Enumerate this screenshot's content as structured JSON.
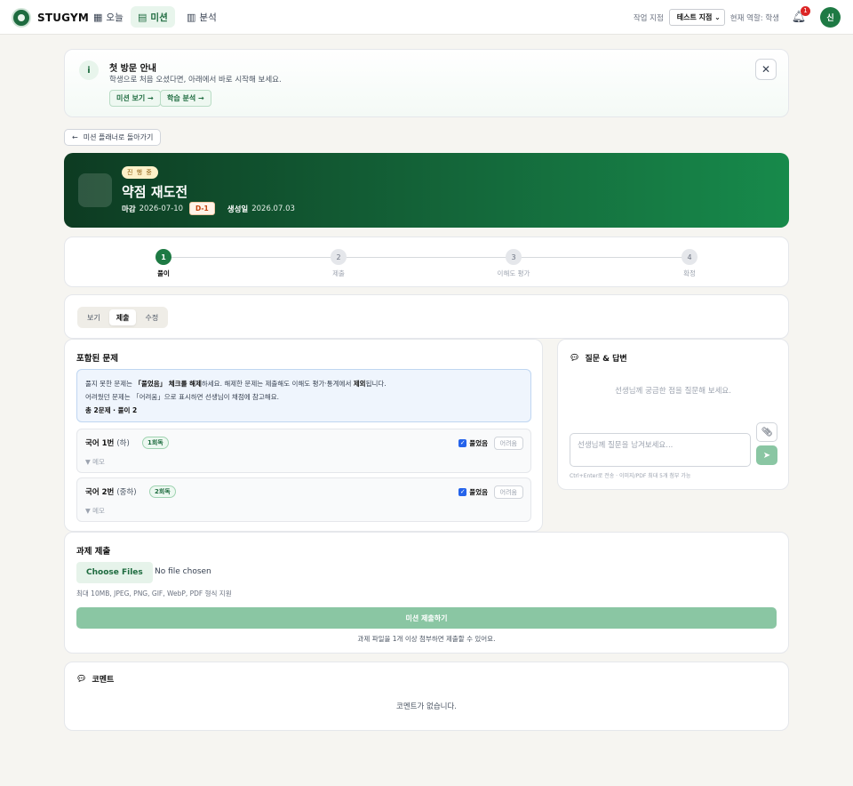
{
  "brand": "STUGYM",
  "nav": {
    "today": "오늘",
    "missions": "미션",
    "analysis": "분석"
  },
  "topbar": {
    "branch_label": "작업 지점",
    "branch_value": "테스트 지점",
    "role_text": "현재 역할: 학생",
    "notification_count": "1",
    "avatar_initial": "신"
  },
  "notice": {
    "title": "첫 방문 안내",
    "description": "학생으로 처음 오셨다면, 아래에서 바로 시작해 보세요.",
    "mission_btn": "미션 보기 →",
    "analysis_btn": "학습 분석 →"
  },
  "back_label": "미션 플래너로 돌아가기",
  "hero": {
    "status": "진 행 중",
    "title": "약점 재도전",
    "due_label": "마감",
    "due_date": "2026-07-10",
    "dday": "D-1",
    "created_label": "생성일",
    "created_date": "2026.07.03"
  },
  "steps": [
    {
      "num": "1",
      "label": "풀이"
    },
    {
      "num": "2",
      "label": "제출"
    },
    {
      "num": "3",
      "label": "이해도 평가"
    },
    {
      "num": "4",
      "label": "확정"
    }
  ],
  "tabs": [
    "보기",
    "제출",
    "수정"
  ],
  "problems": {
    "title": "포함된 문제",
    "info_line1_a": "풀지 못한 문제는 ",
    "info_line1_b": "「풀었음」 체크를 해제",
    "info_line1_c": "하세요. 해제한 문제는 제출해도 이해도 평가·통계에서 ",
    "info_line1_d": "제외",
    "info_line1_e": "됩니다.",
    "info_line2": "어려웠던 문제는 「어려움」으로 표시하면 선생님이 채점에 참고해요.",
    "info_summary": "총 2문제 · 풀이 2",
    "items": [
      {
        "name": "국어 1번",
        "level": "(하)",
        "round": "1회독",
        "memo": "▼ 메모",
        "solved_label": "풀었음",
        "hard_label": "어려움"
      },
      {
        "name": "국어 2번",
        "level": "(중하)",
        "round": "2회독",
        "memo": "▼ 메모",
        "solved_label": "풀었음",
        "hard_label": "어려움"
      }
    ]
  },
  "qna": {
    "title": "질문 & 답변",
    "empty": "선생님께 궁금한 점을 질문해 보세요.",
    "placeholder": "선생님께 질문을 남겨보세요...",
    "hint": "Ctrl+Enter로 전송 · 이미지/PDF 최대 5개 첨부 가능"
  },
  "submission": {
    "title": "과제 제출",
    "file_button": "Choose Files",
    "file_status": "No file chosen",
    "file_hint": "최대 10MB, JPEG, PNG, GIF, WebP, PDF 형식 지원",
    "submit_button": "미션 제출하기",
    "note": "과제 파일을 1개 이상 첨부하면 제출할 수 있어요."
  },
  "comments": {
    "title": "코멘트",
    "empty": "코멘트가 없습니다."
  },
  "colors": {
    "brand": "#1e7a44",
    "hero_start": "#0d3b22",
    "hero_end": "#178a4b",
    "disabled_green": "#8ac6a3"
  }
}
